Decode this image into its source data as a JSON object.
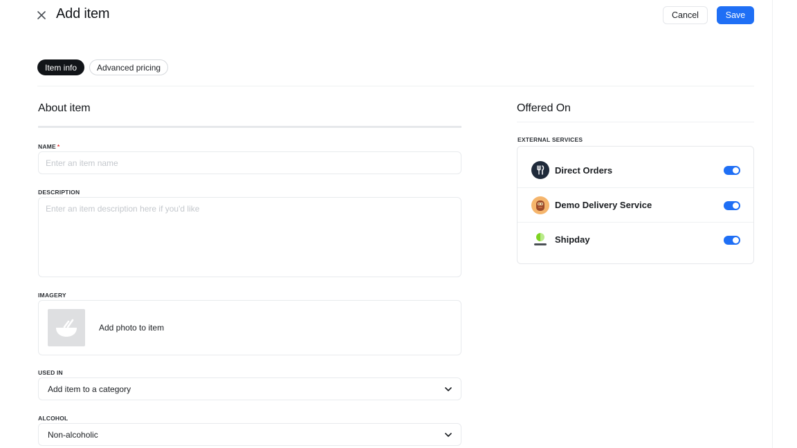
{
  "header": {
    "title": "Add item",
    "cancel_label": "Cancel",
    "save_label": "Save",
    "accent_color": "#1f6ff5"
  },
  "tabs": [
    {
      "label": "Item info",
      "active": true
    },
    {
      "label": "Advanced pricing",
      "active": false
    }
  ],
  "about": {
    "title": "About item",
    "name": {
      "label": "NAME",
      "required_mark": "*",
      "value": "",
      "placeholder": "Enter an item name"
    },
    "description": {
      "label": "DESCRIPTION",
      "value": "",
      "placeholder": "Enter an item description here if you'd like"
    },
    "imagery": {
      "label": "IMAGERY",
      "add_photo_label": "Add photo to item",
      "icon": "bowl-icon"
    },
    "used_in": {
      "label": "USED IN",
      "value": "Add item to a category",
      "icon": "chevron-down-icon"
    },
    "alcohol": {
      "label": "ALCOHOL",
      "value": "Non-alcoholic",
      "icon": "chevron-down-icon"
    }
  },
  "offered_on": {
    "title": "Offered On",
    "external_services_label": "EXTERNAL SERVICES",
    "services": [
      {
        "name": "Direct Orders",
        "icon": "fork-knife-icon",
        "enabled": true
      },
      {
        "name": "Demo Delivery Service",
        "icon": "mascot-icon",
        "enabled": true
      },
      {
        "name": "Shipday",
        "icon": "shipday-logo-icon",
        "enabled": true
      }
    ]
  }
}
